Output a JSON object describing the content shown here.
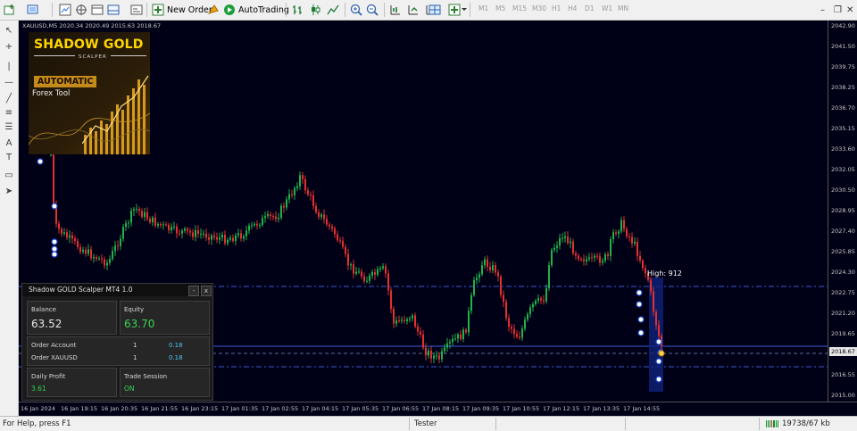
{
  "toolbar": {
    "new_order": "New Order",
    "auto_trading": "AutoTrading",
    "timeframes": [
      "M1",
      "M5",
      "M15",
      "M30",
      "H1",
      "H4",
      "D1",
      "W1",
      "MN"
    ]
  },
  "chart": {
    "symbol_info": "XAUUSD,M5  2020.34 2020.49 2015.63 2018.67",
    "current_price": "2018.67",
    "high_label": "High: 912",
    "price_labels": [
      "2042.90",
      "2041.50",
      "2039.75",
      "2038.25",
      "2036.70",
      "2035.15",
      "2033.60",
      "2032.05",
      "2030.50",
      "2028.95",
      "2027.40",
      "2025.85",
      "2024.30",
      "2022.75",
      "2021.20",
      "2019.65",
      "2018.10",
      "2016.55",
      "2015.00"
    ],
    "time_labels": [
      "16 Jan 2024",
      "16 Jan 19:15",
      "16 Jan 20:35",
      "16 Jan 21:55",
      "16 Jan 23:15",
      "17 Jan 01:35",
      "17 Jan 02:55",
      "17 Jan 04:15",
      "17 Jan 05:35",
      "17 Jan 06:55",
      "17 Jan 08:15",
      "17 Jan 09:35",
      "17 Jan 10:55",
      "17 Jan 12:15",
      "17 Jan 13:35",
      "17 Jan 14:55"
    ],
    "colors": {
      "bull": "#21b24a",
      "bear": "#e2312f",
      "background": "#000016",
      "hline": "#3b5cd6"
    }
  },
  "logo": {
    "title": "SHADOW GOLD",
    "subtitle": "SCALPER",
    "badge": "AUTOMATIC",
    "tagline": "Forex Tool"
  },
  "panel": {
    "title": "Shadow GOLD Scalper MT4 1.0",
    "minimize": "-",
    "close": "x",
    "balance_label": "Balance",
    "balance_value": "63.52",
    "equity_label": "Equity",
    "equity_value": "63.70",
    "order_account_label": "Order Account",
    "order_account_count": "1",
    "order_account_value": "0.18",
    "order_symbol_label": "Order XAUUSD",
    "order_symbol_count": "1",
    "order_symbol_value": "0.18",
    "daily_profit_label": "Daily Profit",
    "daily_profit_value": "3.61",
    "trade_session_label": "Trade Session",
    "trade_session_value": "ON"
  },
  "status": {
    "help": "For Help, press F1",
    "mode": "Tester",
    "traffic": "19738/67 kb"
  }
}
